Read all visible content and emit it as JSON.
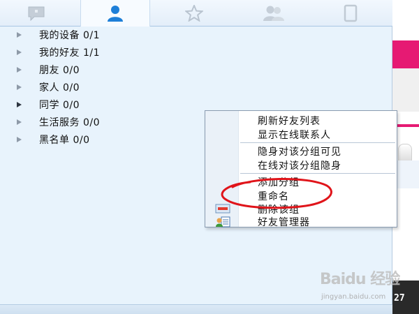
{
  "tabs": [
    {
      "icon": "chat-bubble-icon",
      "active": false
    },
    {
      "icon": "contact-person-icon",
      "active": true
    },
    {
      "icon": "star-icon",
      "active": false
    },
    {
      "icon": "group-people-icon",
      "active": false
    },
    {
      "icon": "device-icon",
      "active": false
    }
  ],
  "groups": [
    {
      "name": "我的设备",
      "count": "0/1"
    },
    {
      "name": "我的好友",
      "count": "1/1"
    },
    {
      "name": "朋友",
      "count": "0/0"
    },
    {
      "name": "家人",
      "count": "0/0"
    },
    {
      "name": "同学",
      "count": "0/0"
    },
    {
      "name": "生活服务",
      "count": "0/0"
    },
    {
      "name": "黑名单",
      "count": "0/0"
    }
  ],
  "group_labels": [
    "我的设备 0/1",
    "我的好友 1/1",
    "朋友 0/0",
    "家人 0/0",
    "同学 0/0",
    "生活服务 0/0",
    "黑名单 0/0"
  ],
  "context_menu": {
    "items": [
      {
        "label": "刷新好友列表"
      },
      {
        "label": "显示在线联系人"
      },
      {
        "label": "隐身对该分组可见"
      },
      {
        "label": "在线对该分组隐身"
      },
      {
        "label": "添加分组"
      },
      {
        "label": "重命名",
        "highlighted_by_annotation": true
      },
      {
        "label": "删除该组",
        "icon": "delete-group-icon"
      },
      {
        "label": "好友管理器",
        "icon": "friend-manager-icon"
      }
    ]
  },
  "background": {
    "number": "27"
  },
  "watermark": {
    "logo": "Baidu 经验",
    "url": "jingyan.baidu.com"
  },
  "colors": {
    "panel_bg": "#e8f3fc",
    "annotation_red": "#e0141a",
    "accent_blue": "#1e7fd8",
    "bg_pink": "#e61a73"
  }
}
